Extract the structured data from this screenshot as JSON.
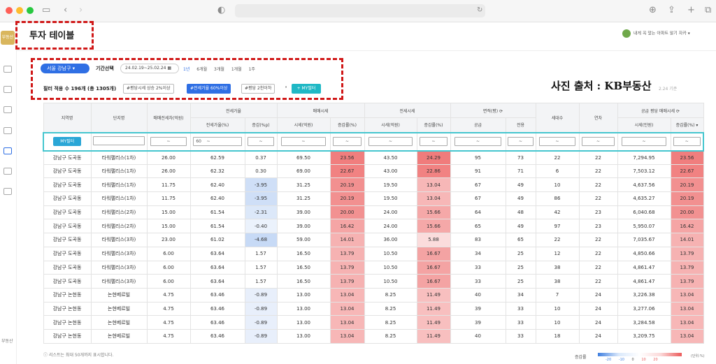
{
  "header": {
    "title": "투자 테이블",
    "user_label": "내게 꼭 맞는 아파트 알기 자카"
  },
  "sidebar": {
    "brand": "부동산",
    "brand_bottom": "부동산"
  },
  "filters": {
    "region": "서울 강남구",
    "period_label": "기간선택",
    "date_range": "24.02.19~25.02.24",
    "period_options": [
      "1년",
      "6개월",
      "3개월",
      "1개월",
      "1주"
    ],
    "count_label": "필터 적용 수 196개 (총 1305개)",
    "chips": [
      "#평당시세 상승 2%이상",
      "#전세가율 60%이상",
      "#평당 2천이하"
    ],
    "my_filter_button": "+ MY필터",
    "faded_text": "2.24 기준"
  },
  "source_caption": "사진 출처 : KB부동산",
  "table": {
    "group_headers": [
      "지역명",
      "단지명",
      "매매전세차(억원)",
      "전세가율",
      "매매시세",
      "전세시세",
      "면적(평)",
      "세대수",
      "연차",
      "공급 평당 매매시세"
    ],
    "sub_headers": [
      "전세가율(%)",
      "증감(%p)",
      "시세(억원)",
      "증감률(%)",
      "시세(억원)",
      "증감률(%)",
      "공급",
      "전용",
      "시세(만원)",
      "증감률(%)"
    ],
    "my_filter_label": "MY필터",
    "filter_value": "60",
    "rows": [
      [
        "강남구 도곡동",
        "타워팰리스(1차)",
        "26.00",
        "62.59",
        "0.37",
        "69.50",
        "23.56",
        "43.50",
        "24.29",
        "95",
        "73",
        "22",
        "22",
        "7,294.95",
        "23.56"
      ],
      [
        "강남구 도곡동",
        "타워팰리스(1차)",
        "26.00",
        "62.32",
        "0.30",
        "69.00",
        "22.67",
        "43.00",
        "22.86",
        "91",
        "71",
        "6",
        "22",
        "7,503.12",
        "22.67"
      ],
      [
        "강남구 도곡동",
        "타워팰리스(1차)",
        "11.75",
        "62.40",
        "-3.95",
        "31.25",
        "20.19",
        "19.50",
        "13.04",
        "67",
        "49",
        "10",
        "22",
        "4,637.56",
        "20.19"
      ],
      [
        "강남구 도곡동",
        "타워팰리스(1차)",
        "11.75",
        "62.40",
        "-3.95",
        "31.25",
        "20.19",
        "19.50",
        "13.04",
        "67",
        "49",
        "86",
        "22",
        "4,635.27",
        "20.19"
      ],
      [
        "강남구 도곡동",
        "타워팰리스(2차)",
        "15.00",
        "61.54",
        "-2.31",
        "39.00",
        "20.00",
        "24.00",
        "15.66",
        "64",
        "48",
        "42",
        "23",
        "6,040.68",
        "20.00"
      ],
      [
        "강남구 도곡동",
        "타워팰리스(2차)",
        "15.00",
        "61.54",
        "-0.40",
        "39.00",
        "16.42",
        "24.00",
        "15.66",
        "65",
        "49",
        "97",
        "23",
        "5,950.07",
        "16.42"
      ],
      [
        "강남구 도곡동",
        "타워팰리스(3차)",
        "23.00",
        "61.02",
        "-4.68",
        "59.00",
        "14.01",
        "36.00",
        "5.88",
        "83",
        "65",
        "22",
        "22",
        "7,035.67",
        "14.01"
      ],
      [
        "강남구 도곡동",
        "타워팰리스(3차)",
        "6.00",
        "63.64",
        "1.57",
        "16.50",
        "13.79",
        "10.50",
        "16.67",
        "34",
        "25",
        "12",
        "22",
        "4,850.66",
        "13.79"
      ],
      [
        "강남구 도곡동",
        "타워팰리스(3차)",
        "6.00",
        "63.64",
        "1.57",
        "16.50",
        "13.79",
        "10.50",
        "16.67",
        "33",
        "25",
        "38",
        "22",
        "4,861.47",
        "13.79"
      ],
      [
        "강남구 도곡동",
        "타워팰리스(3차)",
        "6.00",
        "63.64",
        "1.57",
        "16.50",
        "13.79",
        "10.50",
        "16.67",
        "33",
        "25",
        "38",
        "22",
        "4,861.47",
        "13.79"
      ],
      [
        "강남구 논현동",
        "논현베르빌",
        "4.75",
        "63.46",
        "-0.89",
        "13.00",
        "13.04",
        "8.25",
        "11.49",
        "40",
        "34",
        "7",
        "24",
        "3,226.38",
        "13.04"
      ],
      [
        "강남구 논현동",
        "논현베르빌",
        "4.75",
        "63.46",
        "-0.89",
        "13.00",
        "13.04",
        "8.25",
        "11.49",
        "39",
        "33",
        "10",
        "24",
        "3,277.06",
        "13.04"
      ],
      [
        "강남구 논현동",
        "논현베르빌",
        "4.75",
        "63.46",
        "-0.89",
        "13.00",
        "13.04",
        "8.25",
        "11.49",
        "39",
        "33",
        "10",
        "24",
        "3,284.58",
        "13.04"
      ],
      [
        "강남구 논현동",
        "논현베르빌",
        "4.75",
        "63.46",
        "-0.89",
        "13.00",
        "13.04",
        "8.25",
        "11.49",
        "40",
        "33",
        "18",
        "24",
        "3,209.75",
        "13.04"
      ]
    ]
  },
  "footer": {
    "note": "리스트는 최대 50개까지 표시합니다.",
    "legend_label": "증감률",
    "legend_ticks": [
      "-20",
      "-10",
      "0",
      "10",
      "20"
    ],
    "legend_unit": "(단위:%)"
  },
  "colors": {
    "accent": "#2f6fe4",
    "teal": "#1fb8c5",
    "highlight": "#d01818",
    "up": "#ec5b5b",
    "down": "#3f7fe0"
  }
}
